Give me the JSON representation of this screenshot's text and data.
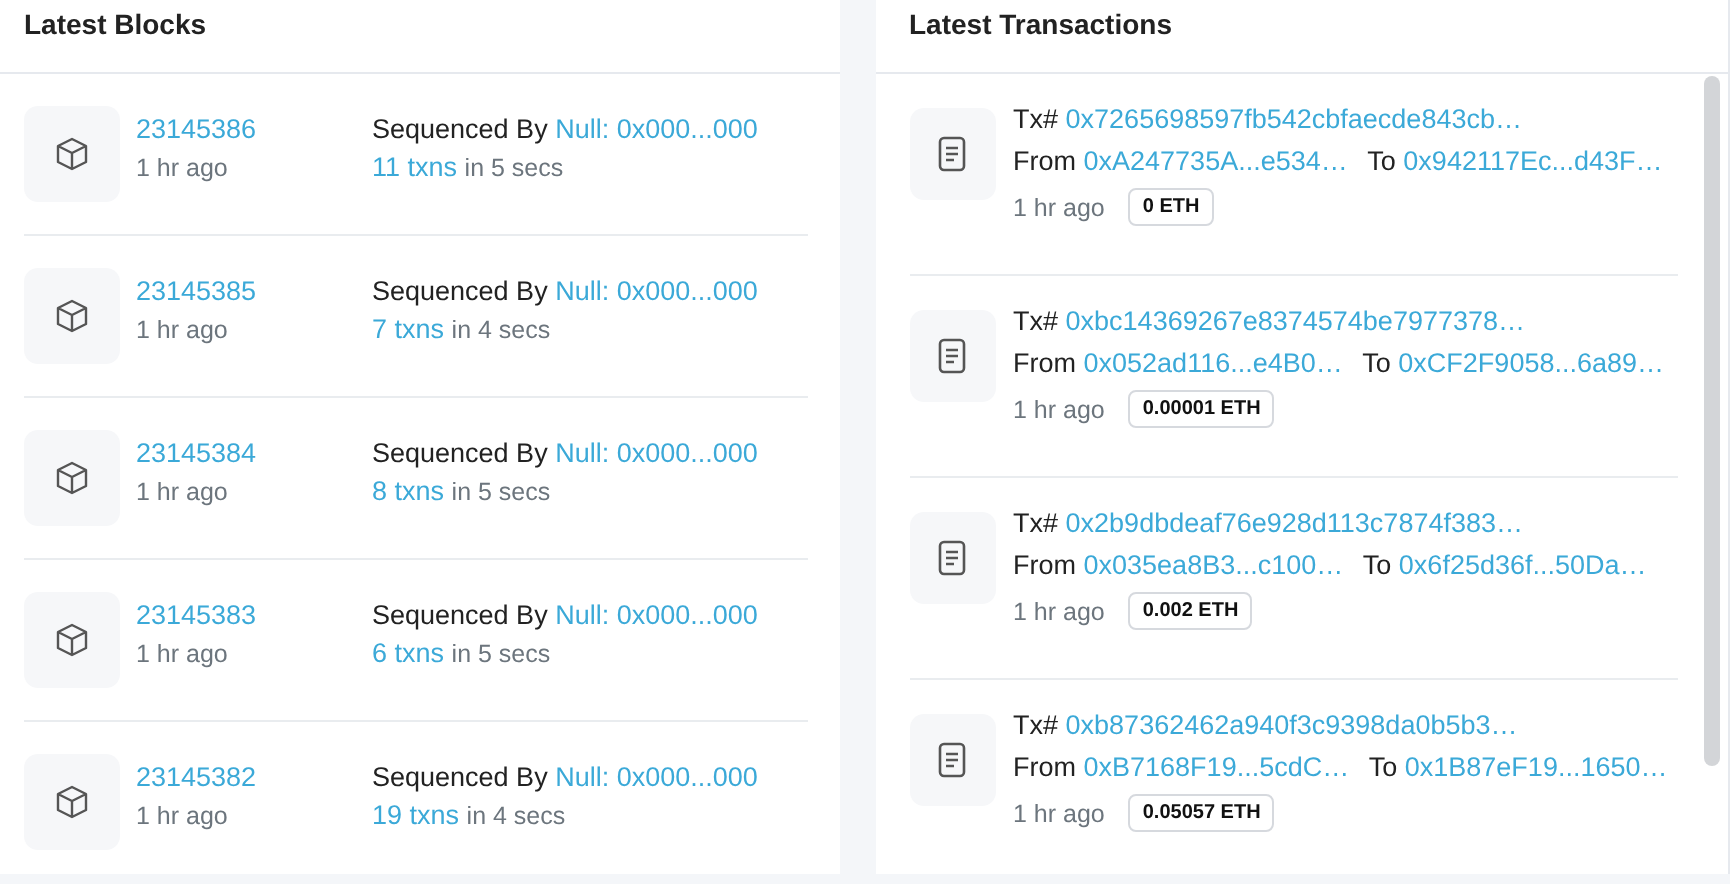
{
  "latest_blocks": {
    "title": "Latest Blocks",
    "rows": [
      {
        "block": "23145386",
        "age": "1 hr ago",
        "sequenced_label": "Sequenced By",
        "sequencer": "Null: 0x000...000",
        "txns": "11 txns",
        "duration": "in 5 secs"
      },
      {
        "block": "23145385",
        "age": "1 hr ago",
        "sequenced_label": "Sequenced By",
        "sequencer": "Null: 0x000...000",
        "txns": "7 txns",
        "duration": "in 4 secs"
      },
      {
        "block": "23145384",
        "age": "1 hr ago",
        "sequenced_label": "Sequenced By",
        "sequencer": "Null: 0x000...000",
        "txns": "8 txns",
        "duration": "in 5 secs"
      },
      {
        "block": "23145383",
        "age": "1 hr ago",
        "sequenced_label": "Sequenced By",
        "sequencer": "Null: 0x000...000",
        "txns": "6 txns",
        "duration": "in 5 secs"
      },
      {
        "block": "23145382",
        "age": "1 hr ago",
        "sequenced_label": "Sequenced By",
        "sequencer": "Null: 0x000...000",
        "txns": "19 txns",
        "duration": "in 4 secs"
      }
    ]
  },
  "latest_transactions": {
    "title": "Latest Transactions",
    "rows": [
      {
        "tx_label": "Tx#",
        "hash": "0x7265698597fb542cbfaecde843cb…",
        "from_label": "From",
        "from": "0xA247735A...e534…",
        "to_label": "To",
        "to": "0x942117Ec...d43F…",
        "age": "1 hr ago",
        "value": "0 ETH"
      },
      {
        "tx_label": "Tx#",
        "hash": "0xbc14369267e8374574be7977378…",
        "from_label": "From",
        "from": "0x052ad116...e4B0…",
        "to_label": "To",
        "to": "0xCF2F9058...6a89…",
        "age": "1 hr ago",
        "value": "0.00001 ETH"
      },
      {
        "tx_label": "Tx#",
        "hash": "0x2b9dbdeaf76e928d113c7874f383…",
        "from_label": "From",
        "from": "0x035ea8B3...c100…",
        "to_label": "To",
        "to": "0x6f25d36f...50Da…",
        "age": "1 hr ago",
        "value": "0.002 ETH"
      },
      {
        "tx_label": "Tx#",
        "hash": "0xb87362462a940f3c9398da0b5b3…",
        "from_label": "From",
        "from": "0xB7168F19...5cdC…",
        "to_label": "To",
        "to": "0x1B87eF19...1650…",
        "age": "1 hr ago",
        "value": "0.05057 ETH"
      }
    ]
  }
}
